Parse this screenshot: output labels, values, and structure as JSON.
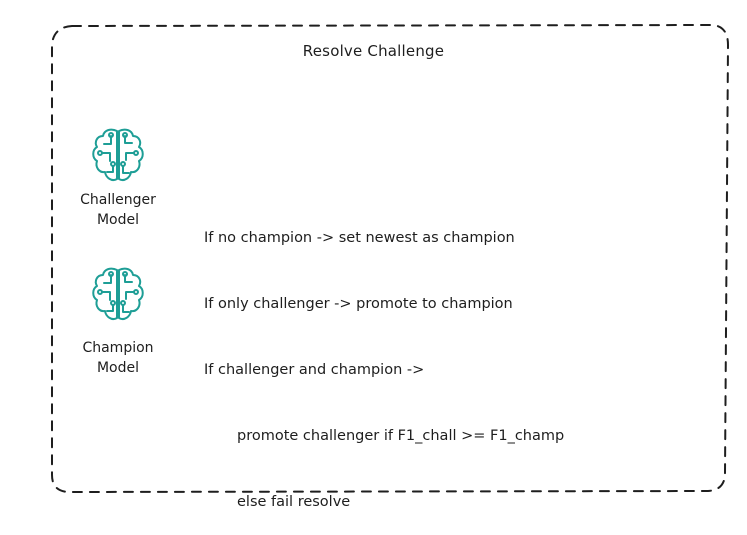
{
  "title": "Resolve Challenge",
  "models": {
    "challenger": {
      "label_line1": "Challenger",
      "label_line2": "Model",
      "icon": "brain-circuit-icon"
    },
    "champion": {
      "label_line1": "Champion",
      "label_line2": "Model",
      "icon": "brain-circuit-icon"
    }
  },
  "rules": [
    "If no champion -> set newest as champion",
    "If only challenger -> promote to champion",
    "If challenger and champion ->",
    "promote challenger if F1_chall >= F1_champ",
    "else fail resolve"
  ],
  "colors": {
    "icon": "#1e9e96",
    "stroke": "#1e1e1e"
  }
}
